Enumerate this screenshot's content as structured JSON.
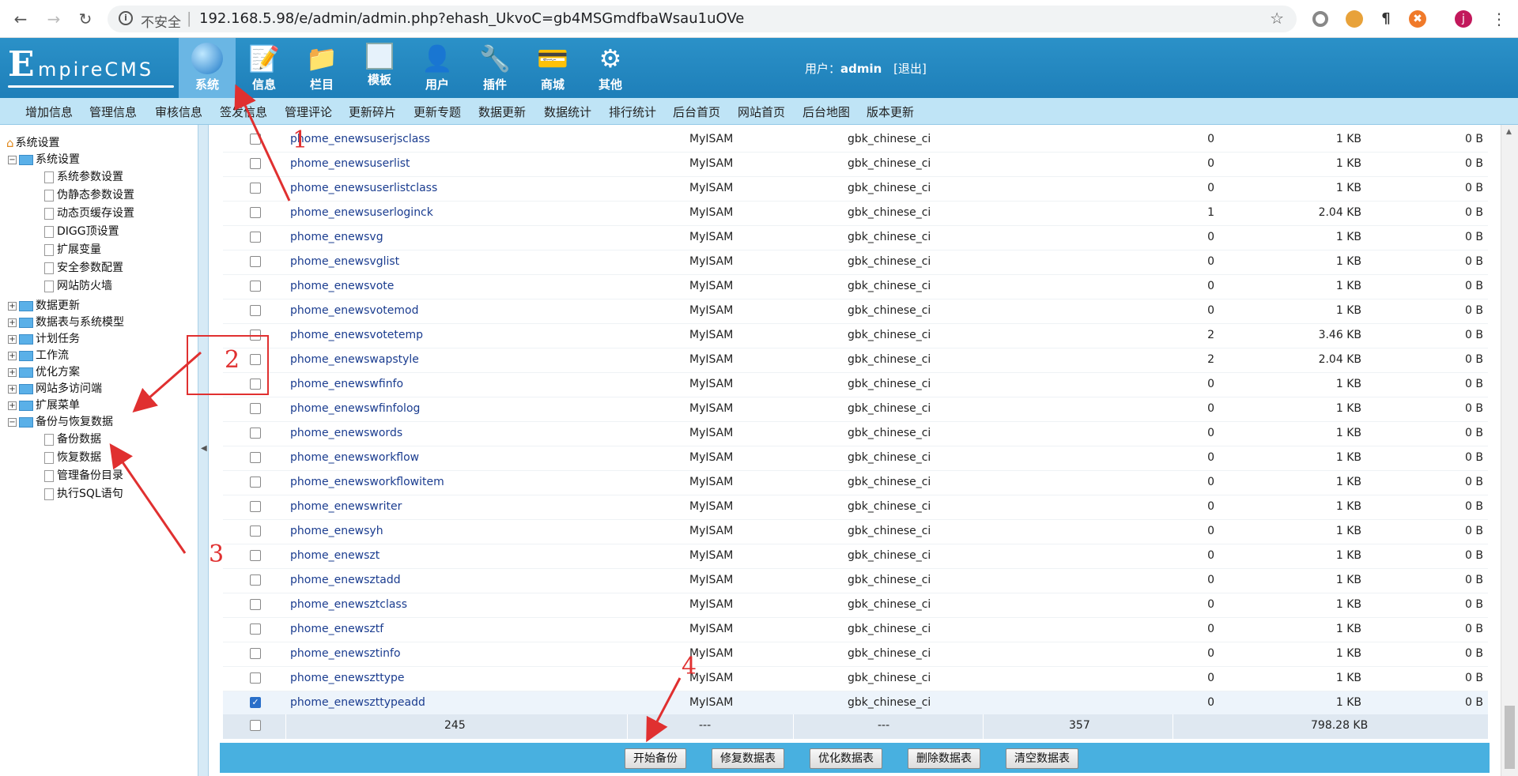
{
  "browser": {
    "insecure_label": "不安全",
    "url": "192.168.5.98/e/admin/admin.php?ehash_UkvoC=gb4MSGmdfbaWsau1uOVe",
    "profile_initial": "j"
  },
  "header": {
    "logo_initial": "E",
    "logo_rest": "mpireCMS",
    "nav": [
      {
        "label": "系统",
        "icon": "globe-icon"
      },
      {
        "label": "信息",
        "icon": "notepad-icon"
      },
      {
        "label": "栏目",
        "icon": "folder-icon"
      },
      {
        "label": "模板",
        "icon": "window-icon"
      },
      {
        "label": "用户",
        "icon": "user-icon"
      },
      {
        "label": "插件",
        "icon": "tools-icon"
      },
      {
        "label": "商城",
        "icon": "card-icon"
      },
      {
        "label": "其他",
        "icon": "gear-icon"
      }
    ],
    "user_label": "用户：",
    "user_name": "admin",
    "logout": "[退出]"
  },
  "subnav": [
    "增加信息",
    "管理信息",
    "审核信息",
    "签发信息",
    "管理评论",
    "更新碎片",
    "更新专题",
    "数据更新",
    "数据统计",
    "排行统计",
    "后台首页",
    "网站首页",
    "后台地图",
    "版本更新"
  ],
  "sidebar": {
    "root": "系统设置",
    "groups": [
      {
        "label": "系统设置",
        "children": [
          "系统参数设置",
          "伪静态参数设置",
          "动态页缓存设置",
          "DIGG顶设置",
          "扩展变量",
          "安全参数配置",
          "网站防火墙"
        ]
      },
      {
        "label": "数据更新"
      },
      {
        "label": "数据表与系统模型"
      },
      {
        "label": "计划任务"
      },
      {
        "label": "工作流"
      },
      {
        "label": "优化方案"
      },
      {
        "label": "网站多访问端"
      },
      {
        "label": "扩展菜单"
      },
      {
        "label": "备份与恢复数据",
        "children": [
          "备份数据",
          "恢复数据",
          "管理备份目录",
          "执行SQL语句"
        ]
      }
    ]
  },
  "table": {
    "rows": [
      {
        "name": "phome_enewsuserjsclass",
        "engine": "MyISAM",
        "collation": "gbk_chinese_ci",
        "rows": "0",
        "size": "1 KB",
        "free": "0 B",
        "checked": false
      },
      {
        "name": "phome_enewsuserlist",
        "engine": "MyISAM",
        "collation": "gbk_chinese_ci",
        "rows": "0",
        "size": "1 KB",
        "free": "0 B",
        "checked": false
      },
      {
        "name": "phome_enewsuserlistclass",
        "engine": "MyISAM",
        "collation": "gbk_chinese_ci",
        "rows": "0",
        "size": "1 KB",
        "free": "0 B",
        "checked": false
      },
      {
        "name": "phome_enewsuserloginck",
        "engine": "MyISAM",
        "collation": "gbk_chinese_ci",
        "rows": "1",
        "size": "2.04 KB",
        "free": "0 B",
        "checked": false
      },
      {
        "name": "phome_enewsvg",
        "engine": "MyISAM",
        "collation": "gbk_chinese_ci",
        "rows": "0",
        "size": "1 KB",
        "free": "0 B",
        "checked": false
      },
      {
        "name": "phome_enewsvglist",
        "engine": "MyISAM",
        "collation": "gbk_chinese_ci",
        "rows": "0",
        "size": "1 KB",
        "free": "0 B",
        "checked": false
      },
      {
        "name": "phome_enewsvote",
        "engine": "MyISAM",
        "collation": "gbk_chinese_ci",
        "rows": "0",
        "size": "1 KB",
        "free": "0 B",
        "checked": false
      },
      {
        "name": "phome_enewsvotemod",
        "engine": "MyISAM",
        "collation": "gbk_chinese_ci",
        "rows": "0",
        "size": "1 KB",
        "free": "0 B",
        "checked": false
      },
      {
        "name": "phome_enewsvotetemp",
        "engine": "MyISAM",
        "collation": "gbk_chinese_ci",
        "rows": "2",
        "size": "3.46 KB",
        "free": "0 B",
        "checked": false
      },
      {
        "name": "phome_enewswapstyle",
        "engine": "MyISAM",
        "collation": "gbk_chinese_ci",
        "rows": "2",
        "size": "2.04 KB",
        "free": "0 B",
        "checked": false
      },
      {
        "name": "phome_enewswfinfo",
        "engine": "MyISAM",
        "collation": "gbk_chinese_ci",
        "rows": "0",
        "size": "1 KB",
        "free": "0 B",
        "checked": false
      },
      {
        "name": "phome_enewswfinfolog",
        "engine": "MyISAM",
        "collation": "gbk_chinese_ci",
        "rows": "0",
        "size": "1 KB",
        "free": "0 B",
        "checked": false
      },
      {
        "name": "phome_enewswords",
        "engine": "MyISAM",
        "collation": "gbk_chinese_ci",
        "rows": "0",
        "size": "1 KB",
        "free": "0 B",
        "checked": false
      },
      {
        "name": "phome_enewsworkflow",
        "engine": "MyISAM",
        "collation": "gbk_chinese_ci",
        "rows": "0",
        "size": "1 KB",
        "free": "0 B",
        "checked": false
      },
      {
        "name": "phome_enewsworkflowitem",
        "engine": "MyISAM",
        "collation": "gbk_chinese_ci",
        "rows": "0",
        "size": "1 KB",
        "free": "0 B",
        "checked": false
      },
      {
        "name": "phome_enewswriter",
        "engine": "MyISAM",
        "collation": "gbk_chinese_ci",
        "rows": "0",
        "size": "1 KB",
        "free": "0 B",
        "checked": false
      },
      {
        "name": "phome_enewsyh",
        "engine": "MyISAM",
        "collation": "gbk_chinese_ci",
        "rows": "0",
        "size": "1 KB",
        "free": "0 B",
        "checked": false
      },
      {
        "name": "phome_enewszt",
        "engine": "MyISAM",
        "collation": "gbk_chinese_ci",
        "rows": "0",
        "size": "1 KB",
        "free": "0 B",
        "checked": false
      },
      {
        "name": "phome_enewsztadd",
        "engine": "MyISAM",
        "collation": "gbk_chinese_ci",
        "rows": "0",
        "size": "1 KB",
        "free": "0 B",
        "checked": false
      },
      {
        "name": "phome_enewsztclass",
        "engine": "MyISAM",
        "collation": "gbk_chinese_ci",
        "rows": "0",
        "size": "1 KB",
        "free": "0 B",
        "checked": false
      },
      {
        "name": "phome_enewsztf",
        "engine": "MyISAM",
        "collation": "gbk_chinese_ci",
        "rows": "0",
        "size": "1 KB",
        "free": "0 B",
        "checked": false
      },
      {
        "name": "phome_enewsztinfo",
        "engine": "MyISAM",
        "collation": "gbk_chinese_ci",
        "rows": "0",
        "size": "1 KB",
        "free": "0 B",
        "checked": false
      },
      {
        "name": "phome_enewszttype",
        "engine": "MyISAM",
        "collation": "gbk_chinese_ci",
        "rows": "0",
        "size": "1 KB",
        "free": "0 B",
        "checked": false
      },
      {
        "name": "phome_enewszttypeadd",
        "engine": "MyISAM",
        "collation": "gbk_chinese_ci",
        "rows": "0",
        "size": "1 KB",
        "free": "0 B",
        "checked": true
      }
    ],
    "summary": {
      "count": "245",
      "engine": "---",
      "collation": "---",
      "rows": "357",
      "size": "798.28 KB"
    }
  },
  "buttons": [
    "开始备份",
    "修复数据表",
    "优化数据表",
    "删除数据表",
    "清空数据表"
  ],
  "annotations": [
    "1",
    "2",
    "3",
    "4"
  ],
  "colors": {
    "header": "#1e7fb9",
    "subnav": "#bfe4f6",
    "button_bar": "#48b0e0",
    "annotation": "#e03030"
  }
}
